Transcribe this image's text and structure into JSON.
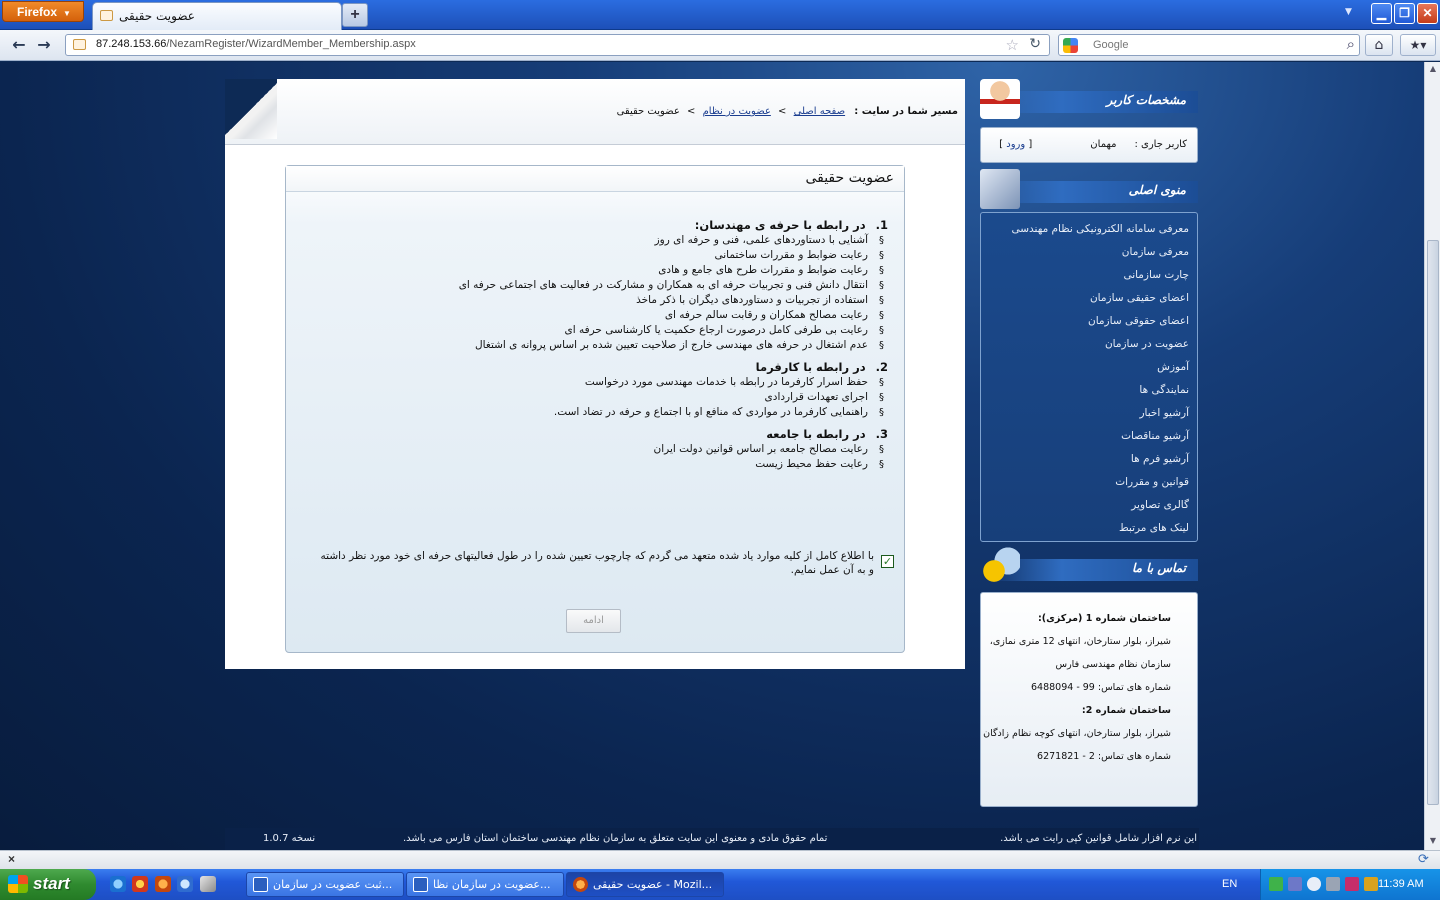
{
  "browser": {
    "menu_label": "Firefox",
    "tab_title": "عضویت حقیقی",
    "new_tab": "+",
    "url_host": "87.248.153.66",
    "url_path": "/NezamRegister/WizardMember_Membership.aspx",
    "search_placeholder": "Google",
    "status_close": "×"
  },
  "page": {
    "breadcrumb_label": "مسیر شما در سایت :",
    "breadcrumb_home": "صفحه اصلی",
    "breadcrumb_sep1": ">",
    "breadcrumb_membership": "عضویت در نظام",
    "breadcrumb_sep2": ">",
    "breadcrumb_current": "عضویت حقیقی",
    "panel_title": "عضویت حقیقی",
    "sections": [
      {
        "num": "1.",
        "title": "در رابطه با حرفه ی مهندسان:",
        "items": [
          "آشنایی با دستاوردهای علمی، فنی و حرفه ای روز",
          "رعایت ضوابط و مقررات ساختمانی",
          "رعایت ضوابط و مقررات طرح های جامع و هادی",
          "انتقال دانش فنی و تجربیات حرفه ای به همکاران و مشارکت در فعالیت های اجتماعی حرفه ای",
          "استفاده از تجربیات و دستاوردهای دیگران با ذکر ماخذ",
          "رعایت مصالح همکاران و رقابت سالم حرفه ای",
          "رعایت بی طرفی کامل درصورت ارجاع حکمیت یا کارشناسی حرفه ای",
          "عدم اشتغال در حرفه های مهندسی خارج از صلاحیت تعیین شده بر اساس پروانه ی اشتغال"
        ]
      },
      {
        "num": "2.",
        "title": "در رابطه با کارفرما",
        "items": [
          "حفظ اسرار کارفرما در رابطه با خدمات مهندسی مورد درخواست",
          "اجرای تعهدات قراردادی",
          "راهنمایی کارفرما در مواردی که منافع او با اجتماع و حرفه در تضاد است."
        ]
      },
      {
        "num": "3.",
        "title": "در رابطه با جامعه",
        "items": [
          "رعایت مصالح جامعه بر اساس قوانین دولت ایران",
          "رعایت حفظ محیط زیست"
        ]
      }
    ],
    "bullet": "§",
    "agree_text": "با اطلاع کامل از کلیه موارد یاد شده متعهد می گردم که چارچوب تعیین شده را در طول فعالیتهای حرفه ای خود مورد نظر داشته و به آن عمل نمایم.",
    "agree_checked": true,
    "continue_label": "ادامه"
  },
  "sidebar": {
    "user_header": "مشخصات کاربر",
    "current_user_label": "کاربر جاری :",
    "current_user_value": "مهمان",
    "login_open": "[",
    "login_link": "ورود",
    "login_close": "]",
    "menu_header": "منوی اصلی",
    "menu_items": [
      "معرفی سامانه الکترونیکی نظام مهندسی",
      "معرفی سازمان",
      "چارت سازمانی",
      "اعضای حقیقی سازمان",
      "اعضای حقوقی سازمان",
      "عضویت در سازمان",
      "آموزش",
      "نمایندگی ها",
      "آرشیو اخبار",
      "آرشیو مناقصات",
      "آرشیو فرم ها",
      "قوانین و مقررات",
      "گالری تصاویر",
      "لینک های مرتبط"
    ],
    "contact_header": "تماس با ما",
    "contact_lines": [
      "ساختمان شماره 1 (مرکزی):",
      "شیراز، بلوار ستارخان، انتهای 12 متری نمازی،",
      "سازمان نظام مهندسی فارس",
      "شماره های تماس: 99 - 6488094",
      "ساختمان شماره 2:",
      "شیراز، بلوار ستارخان، انتهای کوچه نظام زادگان",
      "شماره های تماس: 2 - 6271821"
    ]
  },
  "footer": {
    "copyright": "این نرم افزار شامل قوانین کپی رایت می باشد.",
    "rights": "تمام حقوق مادی و معنوی این سایت متعلق به سازمان نظام مهندسی ساختمان استان فارس می باشد.",
    "version": "نسخه 1.0.7"
  },
  "taskbar": {
    "start_label": "start",
    "tasks": [
      "ثبت عضویت در سازمان...",
      "عضویت در سازمان نظا...",
      "عضویت حقیقی - Mozil..."
    ],
    "language": "EN",
    "clock": "11:39 AM"
  },
  "colors": {
    "page_bg": "#0d2a55",
    "menu_bg": "#1b4a8d",
    "link": "#1a3d8f",
    "taskbar": "#2158d8",
    "start_green": "#2f8a2f"
  }
}
